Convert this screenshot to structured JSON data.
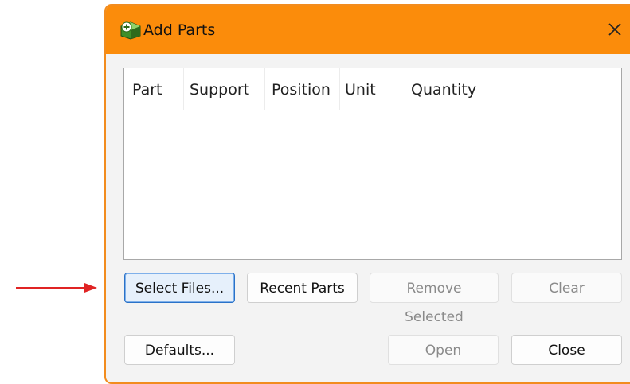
{
  "window": {
    "title": "Add Parts",
    "accent_color": "#fb8c0b",
    "title_icon": "add-parts-icon",
    "close_icon": "close-icon"
  },
  "parts_list": {
    "columns": [
      "Part",
      "Support",
      "Position",
      "Unit",
      "Quantity"
    ],
    "rows": []
  },
  "buttons": {
    "select_files": "Select Files...",
    "recent_parts": "Recent Parts",
    "remove_selected": "Remove Selected",
    "clear": "Clear",
    "defaults": "Defaults...",
    "open": "Open",
    "close": "Close"
  },
  "annotation": {
    "arrow_color": "#e02424"
  }
}
